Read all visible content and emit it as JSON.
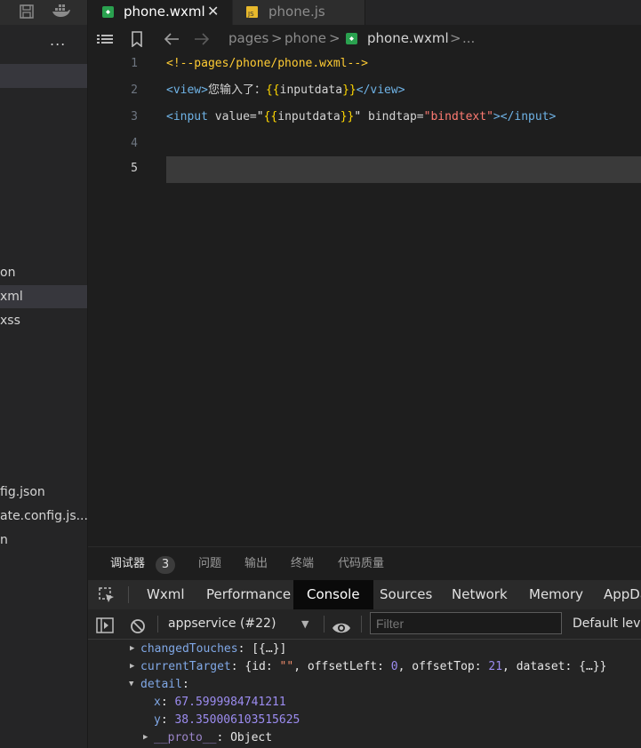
{
  "sidebar": {
    "more": "...",
    "files": [
      {
        "label": "on",
        "active": false
      },
      {
        "label": "xml",
        "active": true
      },
      {
        "label": "xss",
        "active": false
      },
      {
        "label": "fig.json",
        "active": false
      },
      {
        "label": "ate.config.js...",
        "active": false
      },
      {
        "label": "n",
        "active": false
      }
    ]
  },
  "tabs": [
    {
      "label": "phone.wxml",
      "active": true,
      "close": "✕"
    },
    {
      "label": "phone.js",
      "active": false
    }
  ],
  "breadcrumb": {
    "parts": [
      "pages",
      "phone",
      "phone.wxml",
      "..."
    ],
    "sep": ">"
  },
  "editor": {
    "line_numbers": [
      "1",
      "2",
      "3",
      "4",
      "5"
    ],
    "current_line": "5",
    "line1": {
      "comment": "<!--pages/phone/phone.wxml-->"
    },
    "line2": {
      "open_tag": "<view>",
      "text": "您输入了：",
      "brace_open": "{{",
      "expr": "inputdata",
      "brace_close": "}}",
      "close_tag": "</view>"
    },
    "line3": {
      "tag_start": "<input",
      "attr1": " value=",
      "q1": "\"",
      "brace_open": "{{",
      "expr": "inputdata",
      "brace_close": "}}",
      "q2": "\"",
      "attr2": " bindtap=",
      "str2": "\"bindtext\"",
      "tag_end": "></input>"
    }
  },
  "debugger": {
    "tabs": [
      {
        "label": "调试器",
        "active": true
      },
      {
        "label": "问题",
        "active": false
      },
      {
        "label": "输出",
        "active": false
      },
      {
        "label": "终端",
        "active": false
      },
      {
        "label": "代码质量",
        "active": false
      }
    ],
    "badge": "3"
  },
  "devtools": {
    "tabs": [
      {
        "label": "Wxml",
        "active": false
      },
      {
        "label": "Performance",
        "active": false
      },
      {
        "label": "Console",
        "active": true
      },
      {
        "label": "Sources",
        "active": false
      },
      {
        "label": "Network",
        "active": false
      },
      {
        "label": "Memory",
        "active": false
      },
      {
        "label": "AppDa",
        "active": false
      }
    ]
  },
  "console": {
    "context": "appservice (#22)",
    "filter_placeholder": "Filter",
    "levels": "Default leve",
    "lines": {
      "changed_key": "changedTouches",
      "changed_val": "[{…}]",
      "current_key": "currentTarget",
      "current_id_key": "id",
      "current_id_val": "\"\"",
      "offset_left_key": "offsetLeft",
      "offset_left_val": "0",
      "offset_top_key": "offsetTop",
      "offset_top_val": "21",
      "dataset_key": "dataset",
      "dataset_val": "{…}}",
      "detail_key": "detail",
      "x_key": "x",
      "x_val": "67.5999984741211",
      "y_key": "y",
      "y_val": "38.350006103515625",
      "proto_key": "__proto__",
      "proto_val": "Object"
    }
  },
  "colors": {
    "background": "#1e1e1e",
    "sidebar": "#252526",
    "active_tab": "#0a0a0a",
    "comment": "#ffcc33",
    "tag": "#6fb3e6",
    "string": "#ff7b72"
  }
}
